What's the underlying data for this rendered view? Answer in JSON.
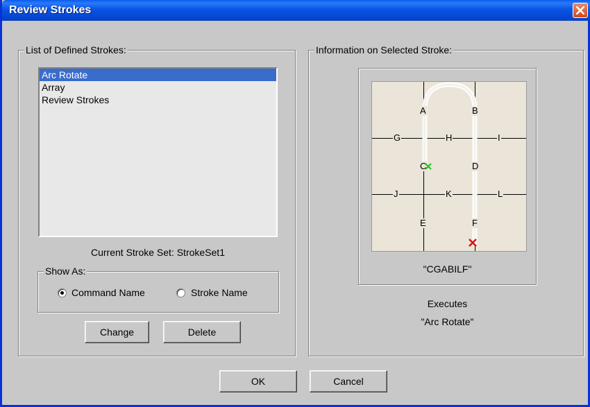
{
  "window": {
    "title": "Review Strokes"
  },
  "list_group": {
    "legend": "List of Defined Strokes:",
    "items": [
      {
        "label": "Arc Rotate",
        "selected": true
      },
      {
        "label": "Array",
        "selected": false
      },
      {
        "label": "Review Strokes",
        "selected": false
      }
    ],
    "current_set": "Current Stroke Set: StrokeSet1"
  },
  "show_as": {
    "legend": "Show As:",
    "options": [
      {
        "label": "Command Name",
        "checked": true
      },
      {
        "label": "Stroke Name",
        "checked": false
      }
    ]
  },
  "list_buttons": {
    "change": "Change",
    "delete": "Delete"
  },
  "info_group": {
    "legend": "Information on Selected Stroke:",
    "grid_labels": [
      "A",
      "B",
      "C",
      "D",
      "E",
      "F",
      "G",
      "H",
      "I",
      "J",
      "K",
      "L"
    ],
    "stroke_code": "\"CGABILF\"",
    "executes_label": "Executes",
    "executes_command": "\"Arc Rotate\""
  },
  "footer": {
    "ok": "OK",
    "cancel": "Cancel"
  },
  "colors": {
    "selection": "#3a6ccc",
    "title_bar": "#0954e4",
    "start_marker": "#22c022",
    "end_marker": "#dd1111"
  },
  "icons": {
    "close": "close-icon"
  }
}
